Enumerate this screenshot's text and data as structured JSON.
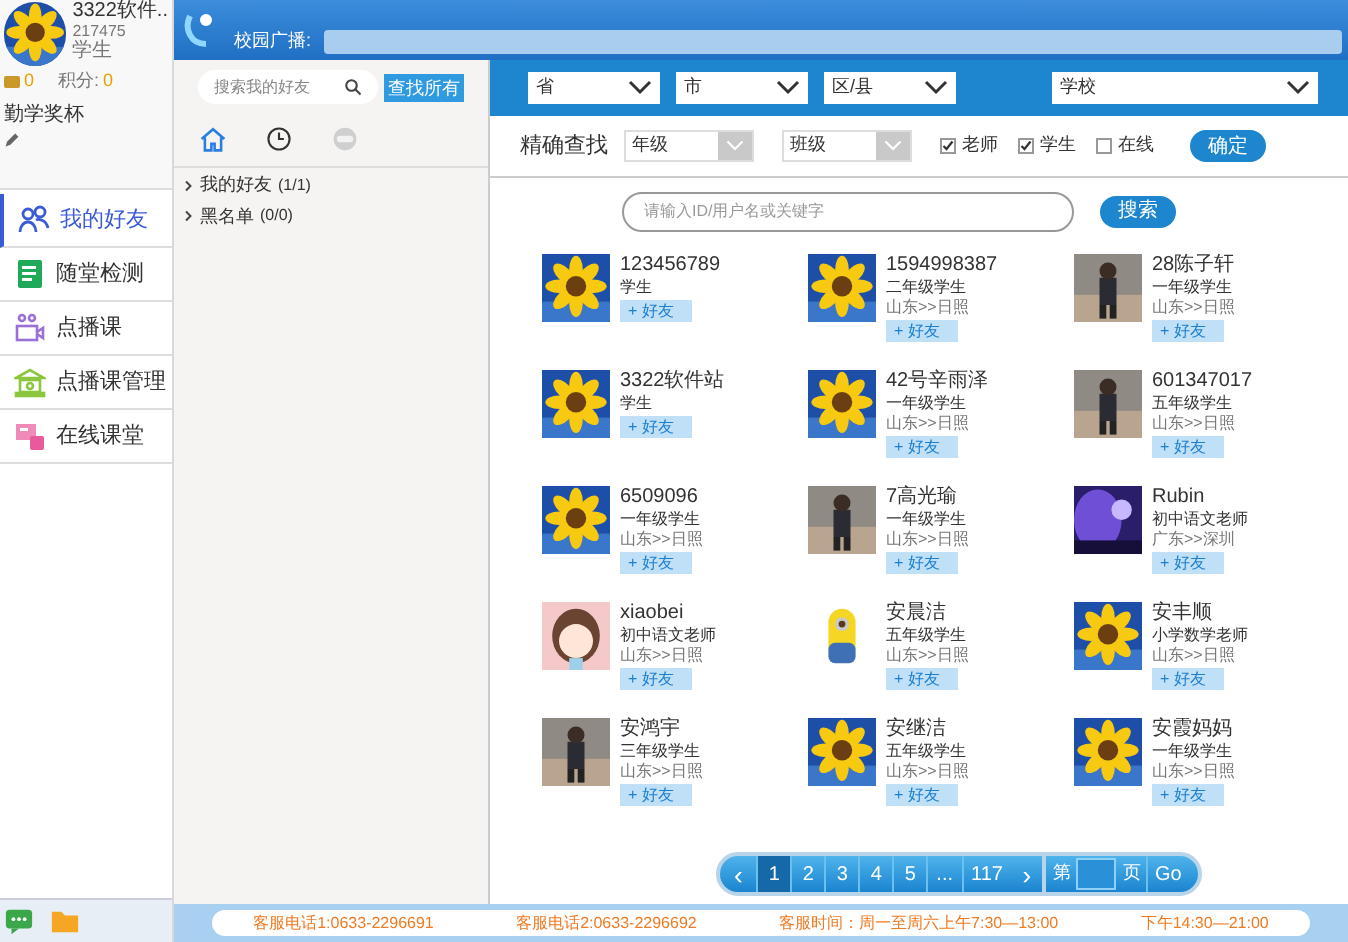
{
  "profile": {
    "name": "3322软件..",
    "id": "217475",
    "role": "学生",
    "coins": "0",
    "points_label": "积分:",
    "points": "0",
    "trophy": "勤学奖杯"
  },
  "header": {
    "broadcast_label": "校园广播:"
  },
  "nav": [
    {
      "label": "我的好友",
      "selected": true
    },
    {
      "label": "随堂检测",
      "selected": false
    },
    {
      "label": "点播课",
      "selected": false
    },
    {
      "label": "点播课管理",
      "selected": false
    },
    {
      "label": "在线课堂",
      "selected": false
    }
  ],
  "friend_panel": {
    "search_placeholder": "搜索我的好友",
    "search_all": "查找所有",
    "tree": [
      {
        "label": "我的好友",
        "count": "(1/1)"
      },
      {
        "label": "黑名单",
        "count": "(0/0)"
      }
    ]
  },
  "filters": {
    "selects": [
      "省",
      "市",
      "区/县",
      "学校"
    ],
    "exact_label": "精确查找",
    "grade": "年级",
    "class": "班级",
    "checks": [
      {
        "label": "老师",
        "checked": true
      },
      {
        "label": "学生",
        "checked": true
      },
      {
        "label": "在线",
        "checked": false
      }
    ],
    "confirm": "确定",
    "keyword_placeholder": "请输入ID/用户名或关键字",
    "search": "搜索"
  },
  "users": [
    {
      "name": "123456789",
      "role": "学生",
      "add": "+ 好友"
    },
    {
      "name": "1594998387",
      "role": "二年级学生",
      "location": "山东>>日照",
      "add": "+ 好友"
    },
    {
      "name": "28陈子轩",
      "role": "一年级学生",
      "location": "山东>>日照",
      "add": "+ 好友"
    },
    {
      "name": "3322软件站",
      "role": "学生",
      "add": "+ 好友"
    },
    {
      "name": "42号辛雨泽",
      "role": "一年级学生",
      "location": "山东>>日照",
      "add": "+ 好友"
    },
    {
      "name": "601347017",
      "role": "五年级学生",
      "location": "山东>>日照",
      "add": "+ 好友"
    },
    {
      "name": "6509096",
      "role": "一年级学生",
      "location": "山东>>日照",
      "add": "+ 好友"
    },
    {
      "name": "7高光瑜",
      "role": "一年级学生",
      "location": "山东>>日照",
      "add": "+ 好友"
    },
    {
      "name": "Rubin",
      "role": "初中语文老师",
      "location": "广东>>深圳",
      "add": "+ 好友"
    },
    {
      "name": "xiaobei",
      "role": "初中语文老师",
      "location": "山东>>日照",
      "add": "+ 好友"
    },
    {
      "name": "安晨洁",
      "role": "五年级学生",
      "location": "山东>>日照",
      "add": "+ 好友"
    },
    {
      "name": "安丰顺",
      "role": "小学数学老师",
      "location": "山东>>日照",
      "add": "+ 好友"
    },
    {
      "name": "安鸿宇",
      "role": "三年级学生",
      "location": "山东>>日照",
      "add": "+ 好友"
    },
    {
      "name": "安继洁",
      "role": "五年级学生",
      "location": "山东>>日照",
      "add": "+ 好友"
    },
    {
      "name": "安霞妈妈",
      "role": "一年级学生",
      "location": "山东>>日照",
      "add": "+ 好友"
    }
  ],
  "pagination": {
    "prev": "‹",
    "pages": [
      {
        "label": "1",
        "selected": true
      },
      {
        "label": "2",
        "selected": false
      },
      {
        "label": "3",
        "selected": false
      },
      {
        "label": "4",
        "selected": false
      },
      {
        "label": "5",
        "selected": false
      },
      {
        "label": "...",
        "selected": false
      },
      {
        "label": "117",
        "selected": false
      }
    ],
    "next": "›",
    "page_prefix": "第",
    "page_suffix": "页",
    "go": "Go"
  },
  "status_bar": [
    "客服电话1:0633-2296691",
    "客服电话2:0633-2296692",
    "客服时间：周一至周六上午7:30—13:00",
    "下午14:30—21:00"
  ]
}
